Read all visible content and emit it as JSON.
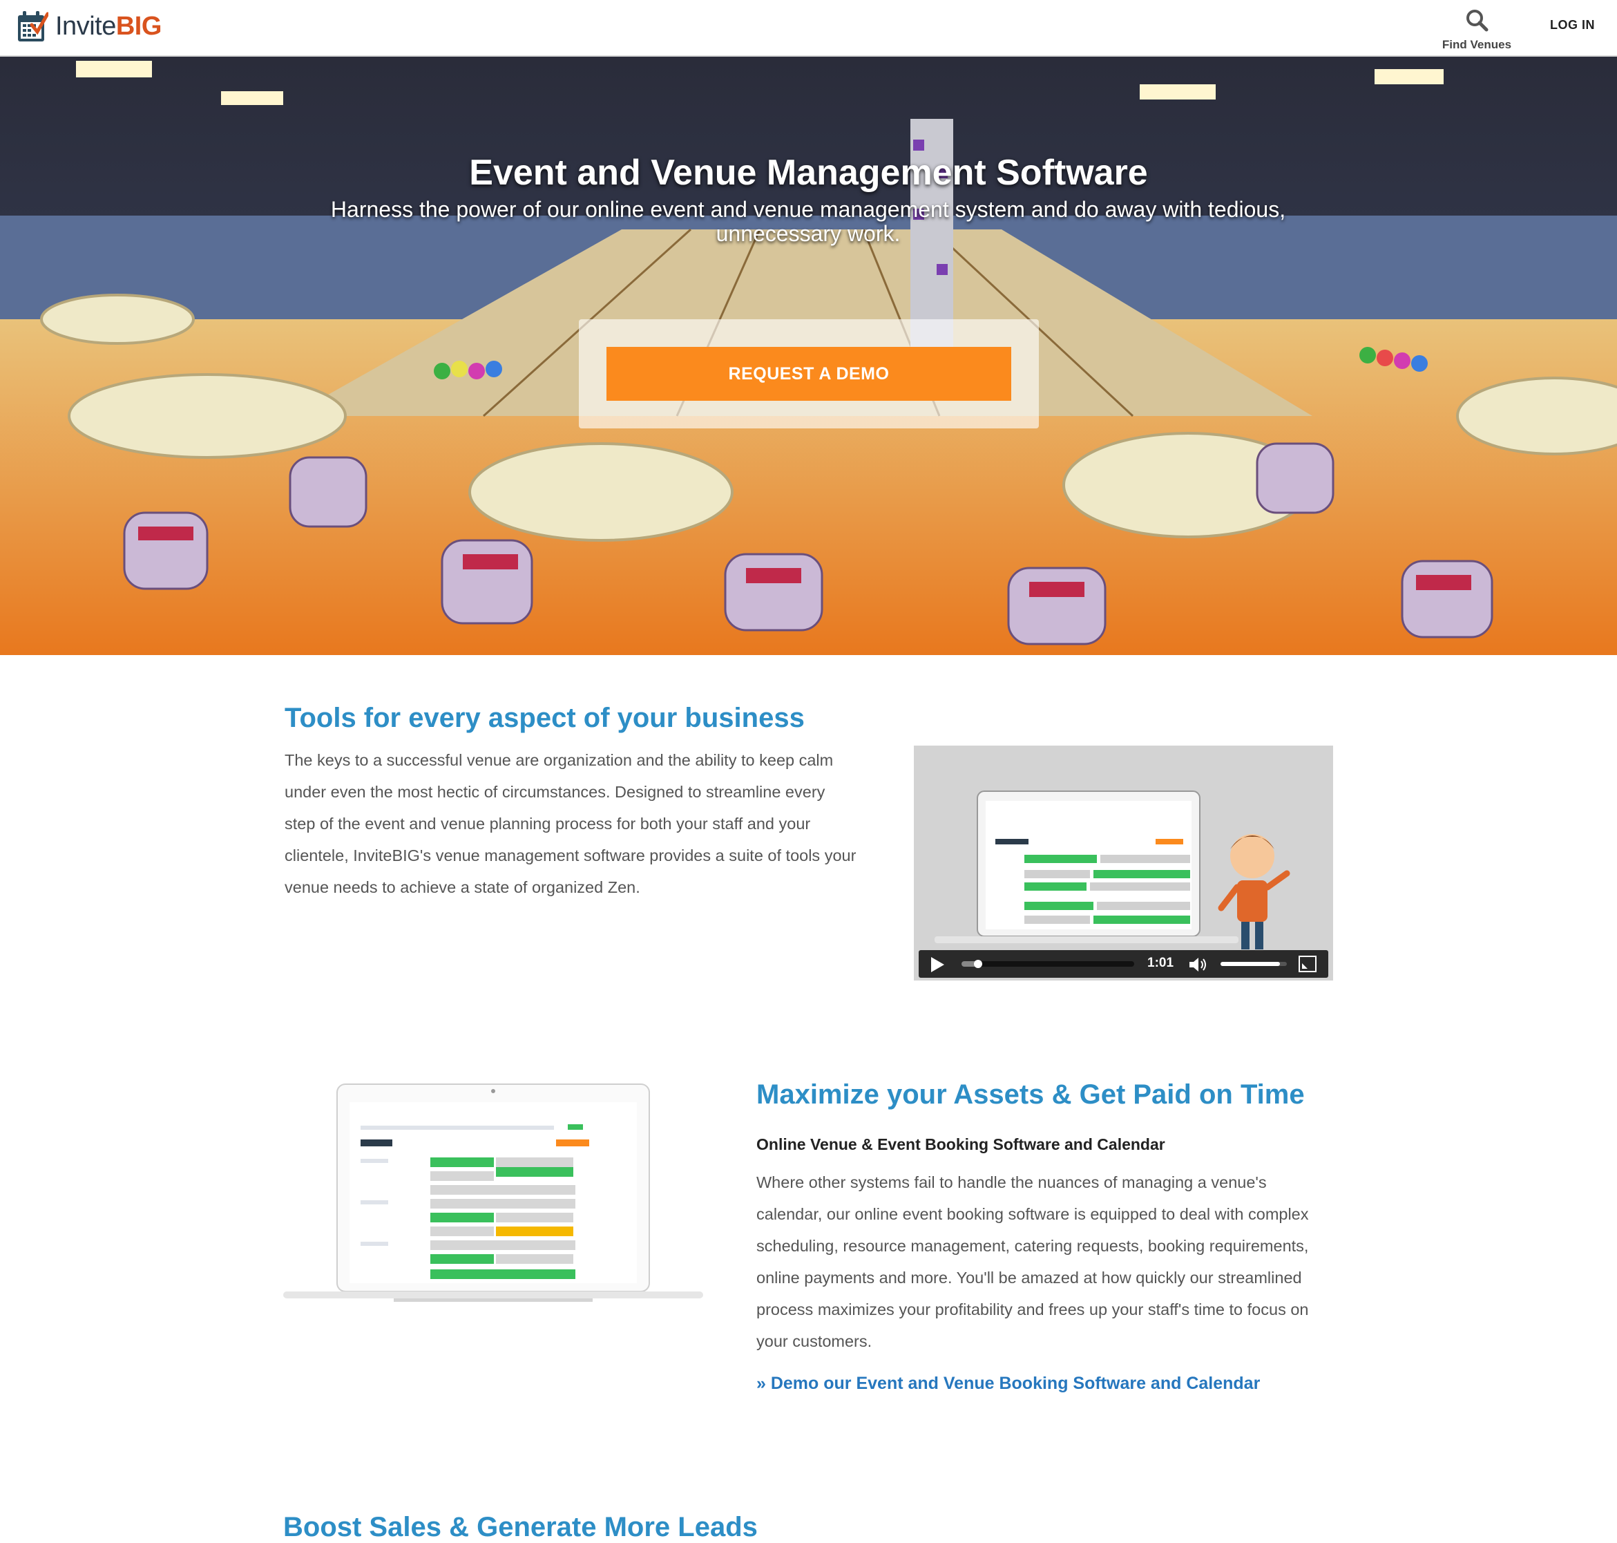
{
  "header": {
    "logo_text_invite": "Invite",
    "logo_text_big": "BIG",
    "find_venues_label": "Find Venues",
    "login_label": "LOG IN"
  },
  "hero": {
    "title": "Event and Venue Management Software",
    "subtitle": "Harness the power of our online event and venue management system and do away with tedious, unnecessary work.",
    "cta_label": "REQUEST A DEMO"
  },
  "section_tools": {
    "heading": "Tools for every aspect of your business",
    "body": "The keys to a successful venue are organization and the ability to keep calm under even the most hectic of circumstances. Designed to streamline every step of the event and venue planning process for both your staff and your clientele, InviteBIG's venue management software provides a suite of tools your venue needs to achieve a state of organized Zen.",
    "video": {
      "time": "1:01",
      "progress": 0.12,
      "volume": 0.9
    }
  },
  "section_assets": {
    "heading": "Maximize your Assets & Get Paid on Time",
    "subheading": "Online Venue & Event Booking Software and Calendar",
    "body": "Where other systems fail to handle the nuances of managing a venue's calendar, our online event booking software is equipped to deal with complex scheduling, resource management, catering requests, booking requirements, online payments and more. You'll be amazed at how quickly our streamlined process maximizes your profitability and frees up your staff's time to focus on your customers.",
    "link": "» Demo our Event and Venue Booking Software and Calendar"
  },
  "next_section": {
    "heading_partial": "Boost Sales & Generate More Leads"
  },
  "colors": {
    "accent_blue": "#2d8ec6",
    "cta_orange": "#fb8a1d",
    "logo_orange": "#d9531e",
    "link_blue": "#2677be"
  }
}
